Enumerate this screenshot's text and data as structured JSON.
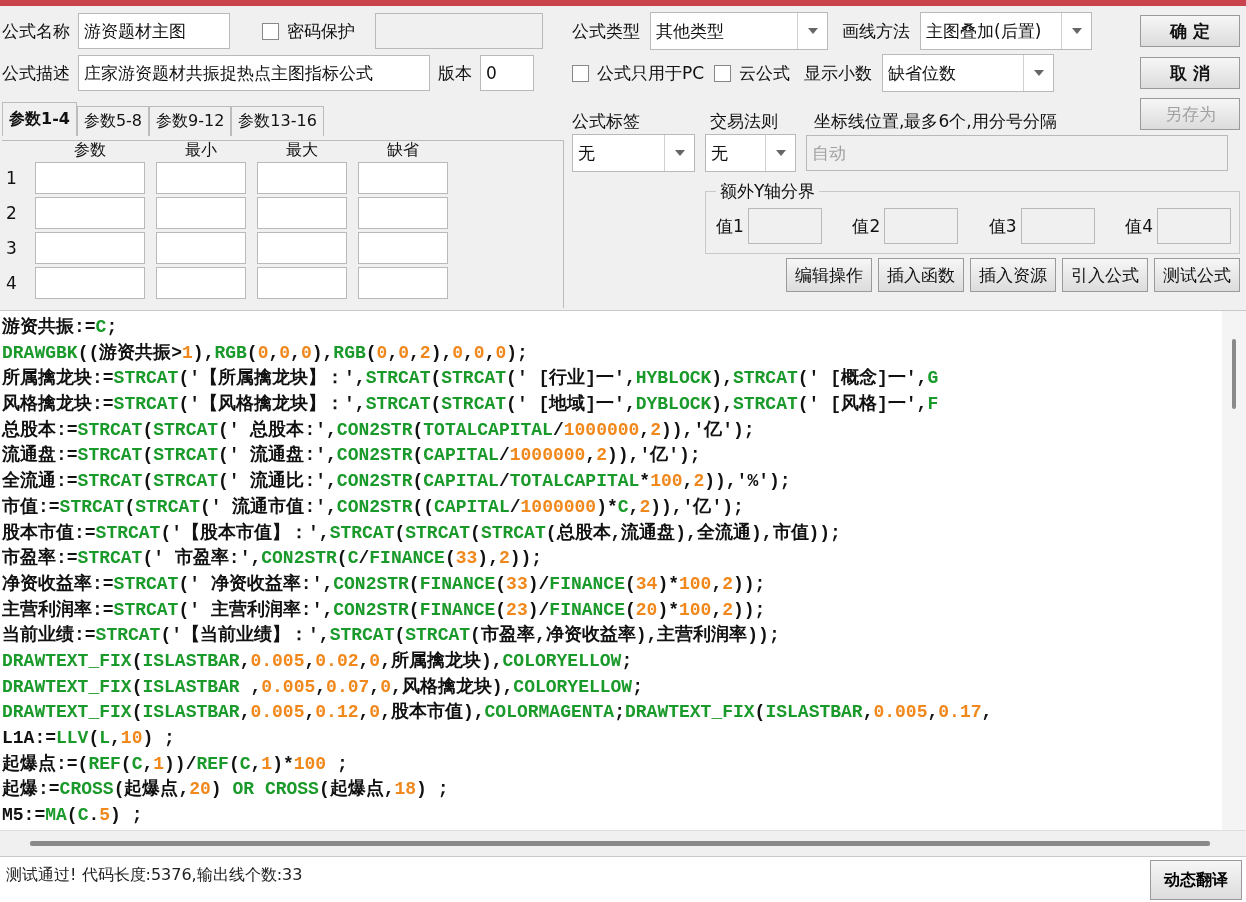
{
  "form": {
    "name": {
      "label": "公式名称",
      "value": "游资题材主图"
    },
    "password": {
      "label": "密码保护",
      "checked": false,
      "field_disabled": true
    },
    "description": {
      "label": "公式描述",
      "value": "庄家游资题材共振捉热点主图指标公式"
    },
    "version": {
      "label": "版本",
      "value": "0"
    },
    "type": {
      "label": "公式类型",
      "value": "其他类型"
    },
    "draw_method": {
      "label": "画线方法",
      "value": "主图叠加(后置)"
    },
    "pc_only": {
      "label": "公式只用于PC",
      "checked": false
    },
    "cloud": {
      "label": "云公式",
      "checked": false
    },
    "decimals": {
      "label": "显示小数",
      "value": "缺省位数"
    },
    "tag": {
      "label": "公式标签",
      "value": "无"
    },
    "trade_rule": {
      "label": "交易法则",
      "value": "无"
    },
    "axis_lines": {
      "label": "坐标线位置,最多6个,用分号分隔",
      "placeholder": "自动",
      "disabled": true
    }
  },
  "side_buttons": [
    {
      "label": "确 定",
      "disabled": false
    },
    {
      "label": "取 消",
      "disabled": false
    },
    {
      "label": "另存为",
      "disabled": true
    }
  ],
  "param_tabs": [
    {
      "label": "参数1-4",
      "selected": true
    },
    {
      "label": "参数5-8",
      "selected": false
    },
    {
      "label": "参数9-12",
      "selected": false
    },
    {
      "label": "参数13-16",
      "selected": false
    }
  ],
  "param_columns": [
    "参数",
    "最小",
    "最大",
    "缺省"
  ],
  "param_rows": [
    "1",
    "2",
    "3",
    "4"
  ],
  "y_axis": {
    "title": "额外Y轴分界",
    "fields": [
      "值1",
      "值2",
      "值3",
      "值4"
    ]
  },
  "actions": [
    "编辑操作",
    "插入函数",
    "插入资源",
    "引入公式",
    "测试公式"
  ],
  "code_lines": [
    "游资共振:=C;",
    "DRAWGBK((游资共振>1),RGB(0,0,0),RGB(0,0,2),0,0,0);",
    "所属擒龙块:=STRCAT('【所属擒龙块】：',STRCAT(STRCAT(' [行业]一',HYBLOCK),STRCAT(' [概念]一',G",
    "风格擒龙块:=STRCAT('【风格擒龙块】：',STRCAT(STRCAT(' [地域]一',DYBLOCK),STRCAT(' [风格]一',F",
    "总股本:=STRCAT(STRCAT(' 总股本:',CON2STR(TOTALCAPITAL/1000000,2)),'亿');",
    "流通盘:=STRCAT(STRCAT(' 流通盘:',CON2STR(CAPITAL/1000000,2)),'亿');",
    "全流通:=STRCAT(STRCAT(' 流通比:',CON2STR(CAPITAL/TOTALCAPITAL*100,2)),'%');",
    "市值:=STRCAT(STRCAT(' 流通市值:',CON2STR((CAPITAL/1000000)*C,2)),'亿');",
    "股本市值:=STRCAT('【股本市值】：',STRCAT(STRCAT(STRCAT(总股本,流通盘),全流通),市值));",
    "市盈率:=STRCAT(' 市盈率:',CON2STR(C/FINANCE(33),2));",
    "净资收益率:=STRCAT(' 净资收益率:',CON2STR(FINANCE(33)/FINANCE(34)*100,2));",
    "主营利润率:=STRCAT(' 主营利润率:',CON2STR(FINANCE(23)/FINANCE(20)*100,2));",
    "当前业绩:=STRCAT('【当前业绩】：',STRCAT(STRCAT(市盈率,净资收益率),主营利润率));",
    "DRAWTEXT_FIX(ISLASTBAR,0.005,0.02,0,所属擒龙块),COLORYELLOW;",
    "DRAWTEXT_FIX(ISLASTBAR ,0.005,0.07,0,风格擒龙块),COLORYELLOW;",
    "DRAWTEXT_FIX(ISLASTBAR,0.005,0.12,0,股本市值),COLORMAGENTA;DRAWTEXT_FIX(ISLASTBAR,0.005,0.17,",
    "L1A:=LLV(L,10) ;",
    "起爆点:=(REF(C,1))/REF(C,1)*100 ;",
    "起爆:=CROSS(起爆点,20) OR CROSS(起爆点,18) ;",
    "M5:=MA(C.5) ;"
  ],
  "status": "测试通过! 代码长度:5376,输出线个数:33",
  "translate_button": "动态翻译"
}
